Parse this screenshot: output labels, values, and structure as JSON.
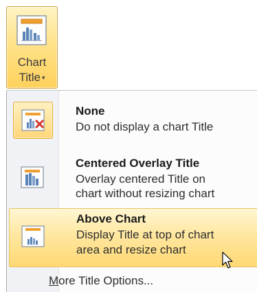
{
  "ribbon": {
    "chart_title_button": {
      "line1": "Chart",
      "line2": "Title",
      "icon": "chart-title-icon",
      "caret": "▾"
    }
  },
  "menu": {
    "items": [
      {
        "title": "None",
        "desc_lines": [
          "Do not display a chart Title"
        ],
        "icon": "chart-title-none-icon",
        "selected": true
      },
      {
        "title": "Centered Overlay Title",
        "desc_lines": [
          "Overlay centered Title on",
          "chart without resizing chart"
        ],
        "icon": "centered-overlay-title-icon",
        "selected": false
      },
      {
        "title": "Above Chart",
        "desc_lines": [
          "Display Title at top of chart",
          "area and resize chart"
        ],
        "icon": "above-chart-title-icon",
        "hovered": true
      }
    ],
    "footer": {
      "accelerator": "M",
      "rest": "ore Title Options..."
    }
  },
  "colors": {
    "highlight_top": "#fff3c4",
    "highlight_bottom": "#ffd15c",
    "highlight_border": "#c9a349",
    "menu_gutter": "#f0f2f5",
    "title_bar_orange": "#f0a030",
    "bar_blue": "#5b84b8",
    "delete_red": "#d4342c"
  }
}
